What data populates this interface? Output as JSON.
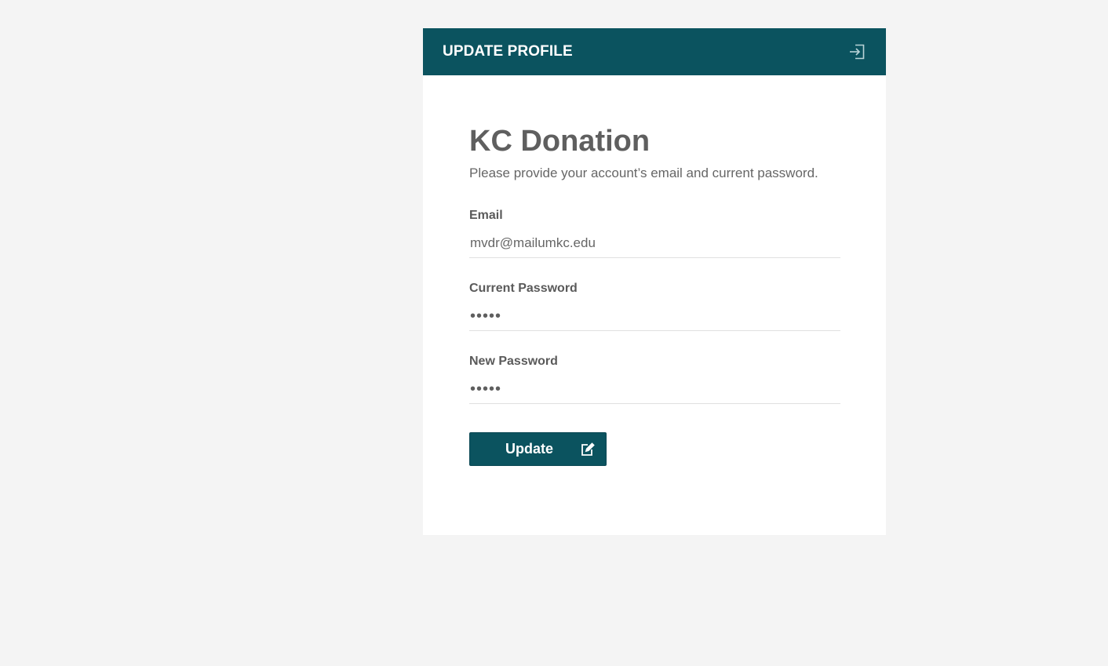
{
  "header": {
    "title": "UPDATE PROFILE",
    "logout_icon": "sign-in-icon"
  },
  "main": {
    "app_title": "KC Donation",
    "subtitle": "Please provide your account’s email and current password."
  },
  "form": {
    "email": {
      "label": "Email",
      "value": "mvdr@mailumkc.edu"
    },
    "current_password": {
      "label": "Current Password",
      "value": "•••••"
    },
    "new_password": {
      "label": "New Password",
      "value": "•••••"
    },
    "submit": {
      "label": "Update",
      "icon": "edit-icon"
    }
  },
  "colors": {
    "brand": "#0b535f",
    "page_background": "#f4f4f4",
    "text": "#5f5f5f"
  }
}
